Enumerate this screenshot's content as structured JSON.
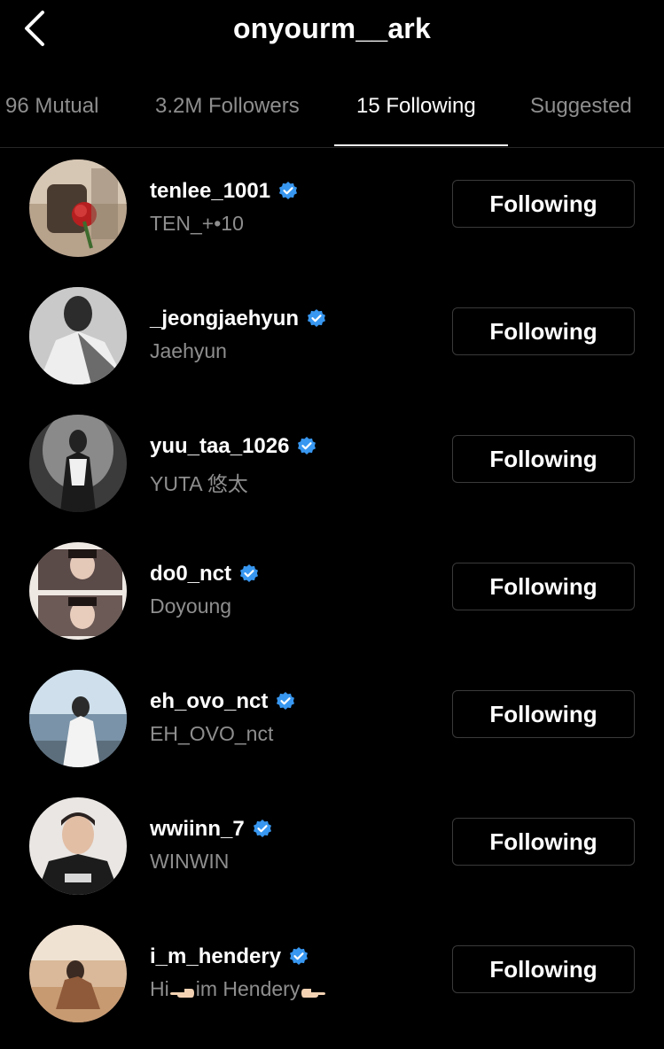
{
  "header": {
    "title": "onyourm__ark",
    "back_icon": "chevron-left-icon"
  },
  "tabs": [
    {
      "label": "96 Mutual",
      "active": false
    },
    {
      "label": "3.2M Followers",
      "active": false
    },
    {
      "label": "15 Following",
      "active": true
    },
    {
      "label": "Suggested",
      "active": false
    }
  ],
  "accounts": [
    {
      "username": "tenlee_1001",
      "full_name": "TEN_+•10",
      "verified": true,
      "button": "Following"
    },
    {
      "username": "_jeongjaehyun",
      "full_name": "Jaehyun",
      "verified": true,
      "button": "Following"
    },
    {
      "username": "yuu_taa_1026",
      "full_name": "YUTA 悠太",
      "verified": true,
      "button": "Following"
    },
    {
      "username": "do0_nct",
      "full_name": "Doyoung",
      "verified": true,
      "button": "Following"
    },
    {
      "username": "eh_ovo_nct",
      "full_name": "EH_OVO_nct",
      "verified": true,
      "button": "Following"
    },
    {
      "username": "wwiinn_7",
      "full_name": "WINWIN",
      "verified": true,
      "button": "Following"
    },
    {
      "username": "i_m_hendery",
      "full_name_prefix": "Hi",
      "full_name_middle": "im Hendery",
      "verified": true,
      "button": "Following"
    }
  ],
  "colors": {
    "background": "#000000",
    "secondary_text": "#8e8e8e",
    "verified_badge": "#3897f0",
    "button_border": "#3a3a3a"
  }
}
